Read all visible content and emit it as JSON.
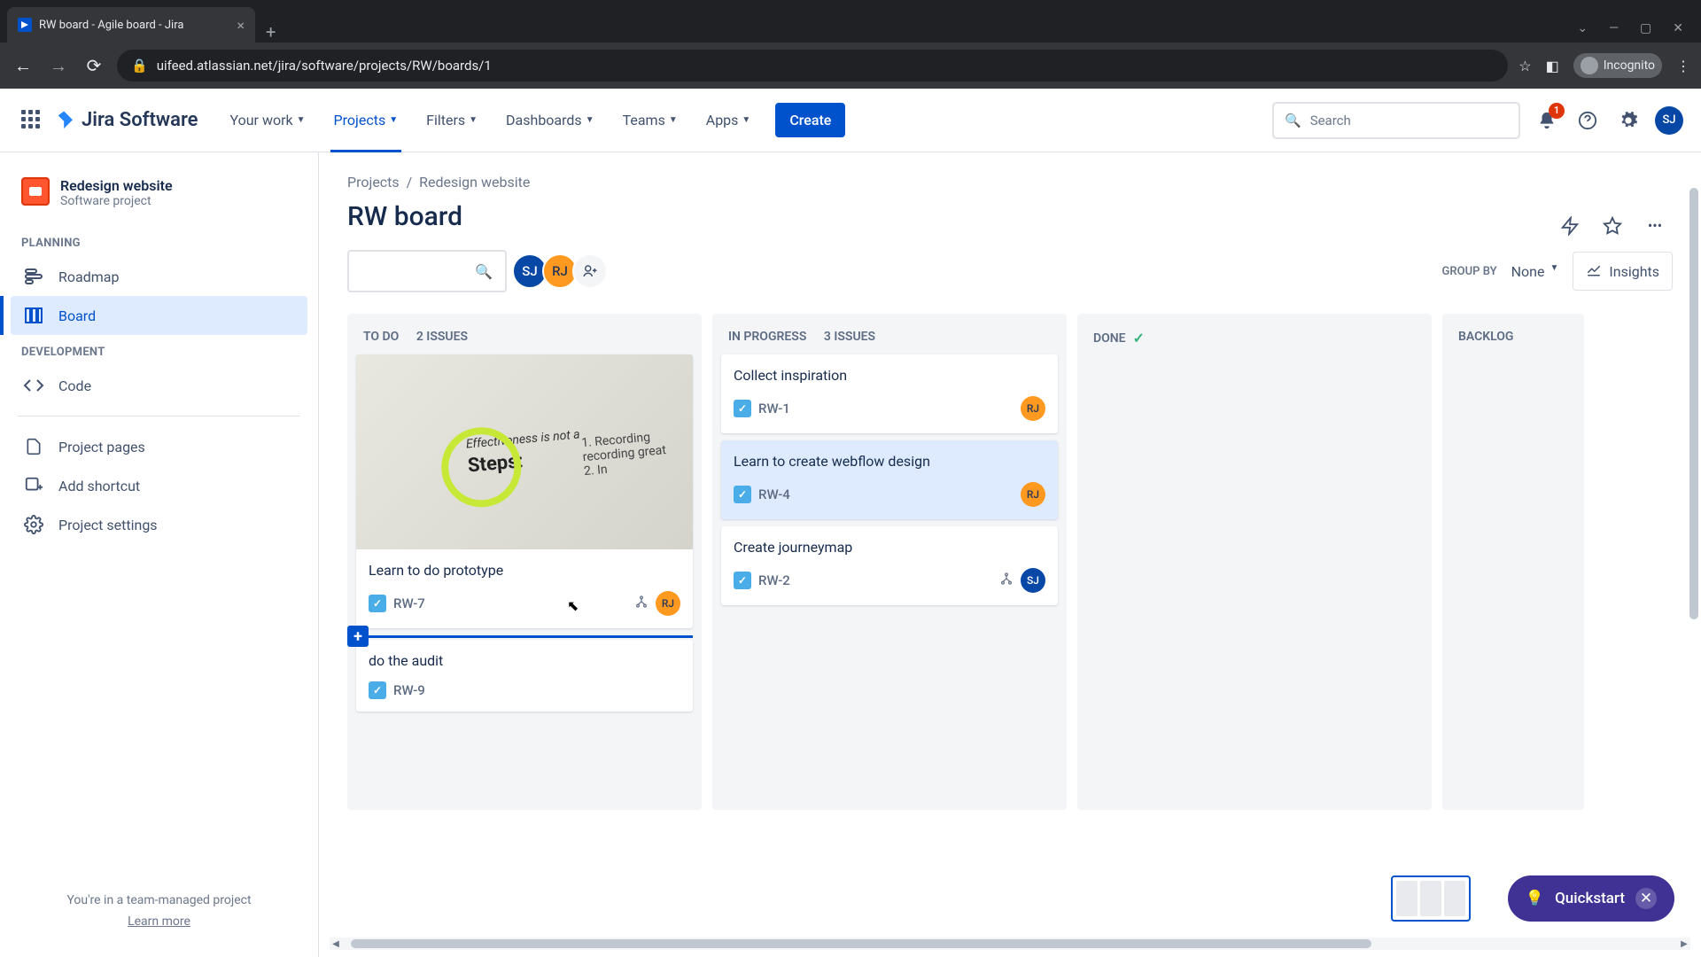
{
  "browser": {
    "tab_title": "RW board - Agile board - Jira",
    "url": "uifeed.atlassian.net/jira/software/projects/RW/boards/1",
    "incognito_label": "Incognito"
  },
  "header": {
    "logo": "Jira Software",
    "nav": [
      "Your work",
      "Projects",
      "Filters",
      "Dashboards",
      "Teams",
      "Apps"
    ],
    "active_nav_index": 1,
    "create": "Create",
    "search_placeholder": "Search",
    "notif_count": "1",
    "user_initials": "SJ"
  },
  "sidebar": {
    "project_name": "Redesign website",
    "project_type": "Software project",
    "sections": {
      "planning": {
        "label": "PLANNING",
        "items": [
          "Roadmap",
          "Board"
        ]
      },
      "development": {
        "label": "DEVELOPMENT",
        "items": [
          "Code"
        ]
      },
      "other": [
        "Project pages",
        "Add shortcut",
        "Project settings"
      ]
    },
    "active_item": "Board",
    "footer_text": "You're in a team-managed project",
    "footer_link": "Learn more"
  },
  "breadcrumb": {
    "root": "Projects",
    "project": "Redesign website"
  },
  "board": {
    "title": "RW board",
    "group_by_label": "GROUP BY",
    "group_by_value": "None",
    "insights": "Insights",
    "members": [
      "SJ",
      "RJ"
    ],
    "columns": [
      {
        "name": "TO DO",
        "count": "2 ISSUES"
      },
      {
        "name": "IN PROGRESS",
        "count": "3 ISSUES"
      },
      {
        "name": "DONE",
        "count": ""
      },
      {
        "name": "BACKLOG",
        "count": ""
      }
    ],
    "cards": {
      "todo": [
        {
          "title": "Learn to do prototype",
          "key": "RW-7",
          "assignee": "RJ",
          "has_image": true,
          "has_children": true
        },
        {
          "title": "do the audit",
          "key": "RW-9",
          "assignee": null,
          "has_image": false,
          "has_children": false
        }
      ],
      "in_progress": [
        {
          "title": "Collect inspiration",
          "key": "RW-1",
          "assignee": "RJ",
          "highlighted": false
        },
        {
          "title": "Learn to create webflow design",
          "key": "RW-4",
          "assignee": "RJ",
          "highlighted": true
        },
        {
          "title": "Create journeymap",
          "key": "RW-2",
          "assignee": "SJ",
          "has_children": true
        }
      ]
    },
    "card_image_words": {
      "w1": "Effectiveness is not a",
      "w2": "Steps:",
      "w3": "1. Recording recording great",
      "w4": "2. In"
    }
  },
  "quickstart": "Quickstart"
}
